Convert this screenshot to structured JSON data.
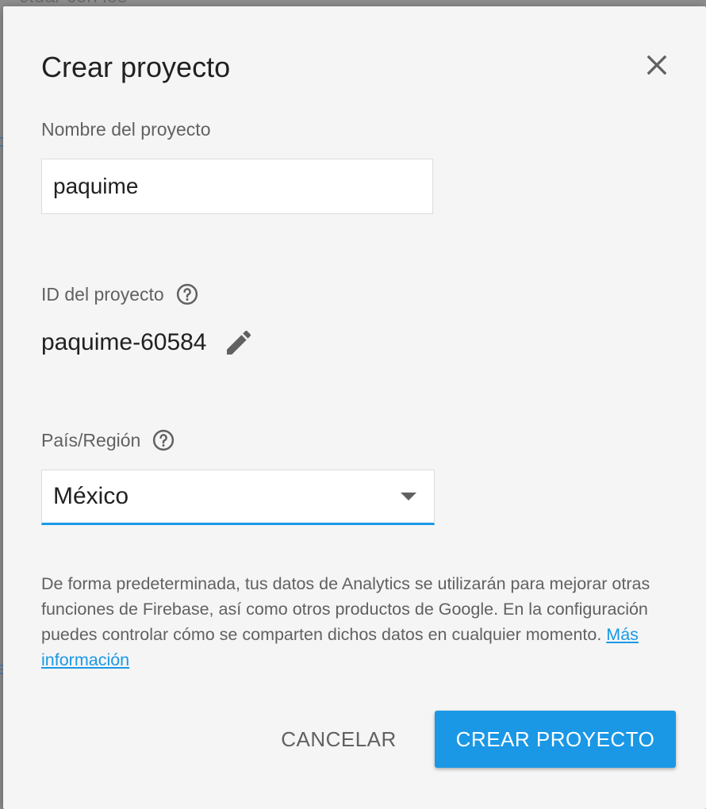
{
  "background": {
    "partial_text": "ctuar con los"
  },
  "dialog": {
    "title": "Crear proyecto",
    "close_icon": "close-icon",
    "project_name": {
      "label": "Nombre del proyecto",
      "value": "paquime"
    },
    "project_id": {
      "label": "ID del proyecto",
      "help_icon": "help-circle-icon",
      "value": "paquime-60584",
      "edit_icon": "pencil-icon"
    },
    "country": {
      "label": "País/Región",
      "help_icon": "help-circle-icon",
      "selected": "México"
    },
    "disclaimer": {
      "text": "De forma predeterminada, tus datos de Analytics se utilizarán para mejorar otras funciones de Firebase, así como otros productos de Google. En la configuración puedes controlar cómo se comparten dichos datos en cualquier momento. ",
      "link": "Más información"
    },
    "buttons": {
      "cancel": "CANCELAR",
      "create": "CREAR PROYECTO"
    }
  },
  "colors": {
    "accent": "#1a98e6",
    "dialog_bg": "#f5f5f5",
    "text_primary": "#212121",
    "text_secondary": "#616161"
  }
}
